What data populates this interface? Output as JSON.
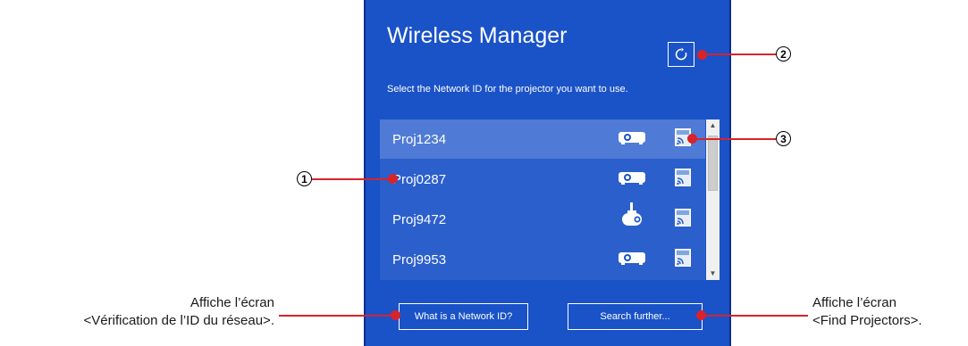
{
  "window": {
    "title": "Wireless Manager",
    "subtitle": "Select the Network ID for the projector you want to use.",
    "refresh_icon": "refresh-icon"
  },
  "projectors": [
    {
      "name": "Proj1234",
      "type_icon": "projector-icon",
      "conn_icon": "wireless-screen-icon",
      "selected": true
    },
    {
      "name": "Proj0287",
      "type_icon": "projector-icon",
      "conn_icon": "wireless-screen-icon",
      "selected": false
    },
    {
      "name": "Proj9472",
      "type_icon": "ceiling-projector-icon",
      "conn_icon": "wireless-screen-icon",
      "selected": false
    },
    {
      "name": "Proj9953",
      "type_icon": "projector-icon",
      "conn_icon": "wireless-screen-icon",
      "selected": false
    }
  ],
  "buttons": {
    "what_is_network_id": "What is a Network ID?",
    "search_further": "Search further..."
  },
  "callouts": {
    "n1": "1",
    "n2": "2",
    "n3": "3",
    "left_note_line1": "Affiche l’écran",
    "left_note_line2": "<Vérification de l’ID du réseau>.",
    "right_note_line1": "Affiche l’écran",
    "right_note_line2": "<Find Projectors>."
  },
  "colors": {
    "panel": "#1a52c8",
    "list": "#2b5fcc",
    "selected_row": "#4f7bd6",
    "callout": "#d8232a"
  }
}
